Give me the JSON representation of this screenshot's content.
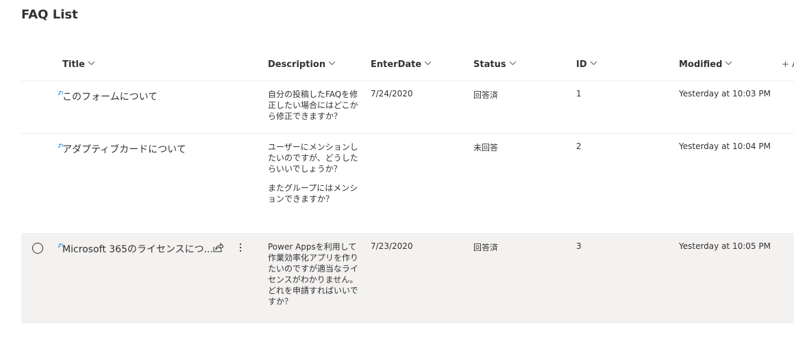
{
  "page": {
    "title": "FAQ List"
  },
  "columns": {
    "title": "Title",
    "description": "Description",
    "enter_date": "EnterDate",
    "status": "Status",
    "id": "ID",
    "modified": "Modified",
    "add_column": "+ A"
  },
  "icons": {
    "new_item": "new-item-sparkle-icon",
    "chevron": "chevron-down-icon",
    "share": "share-icon",
    "more": "more-vertical-icon",
    "radio": "row-select-radio"
  },
  "colors": {
    "new_icon": "#0078d4",
    "selected_row_bg": "#f3f2f1",
    "divider": "#edebe9"
  },
  "rows": [
    {
      "title": "このフォームについて",
      "description": [
        "自分の投稿したFAQを修正したい場合にはどこから修正できますか？"
      ],
      "enter_date": "7/24/2020",
      "status": "回答済",
      "id": "1",
      "modified": "Yesterday at 10:03 PM"
    },
    {
      "title": "アダプティブカードについて",
      "description": [
        "ユーザーにメンションしたいのですが、どうしたらいいでしょうか？",
        "またグループにはメンションできますか？"
      ],
      "enter_date": "",
      "status": "未回答",
      "id": "2",
      "modified": "Yesterday at 10:04 PM"
    },
    {
      "title": "Microsoft 365のライセンスにつ...",
      "description": [
        "Power Appsを利用して作業効率化アプリを作りたいのですが適当なライセンスがわかりません。どれを申請すればいいですか？"
      ],
      "enter_date": "7/23/2020",
      "status": "回答済",
      "id": "3",
      "modified": "Yesterday at 10:05 PM"
    }
  ]
}
